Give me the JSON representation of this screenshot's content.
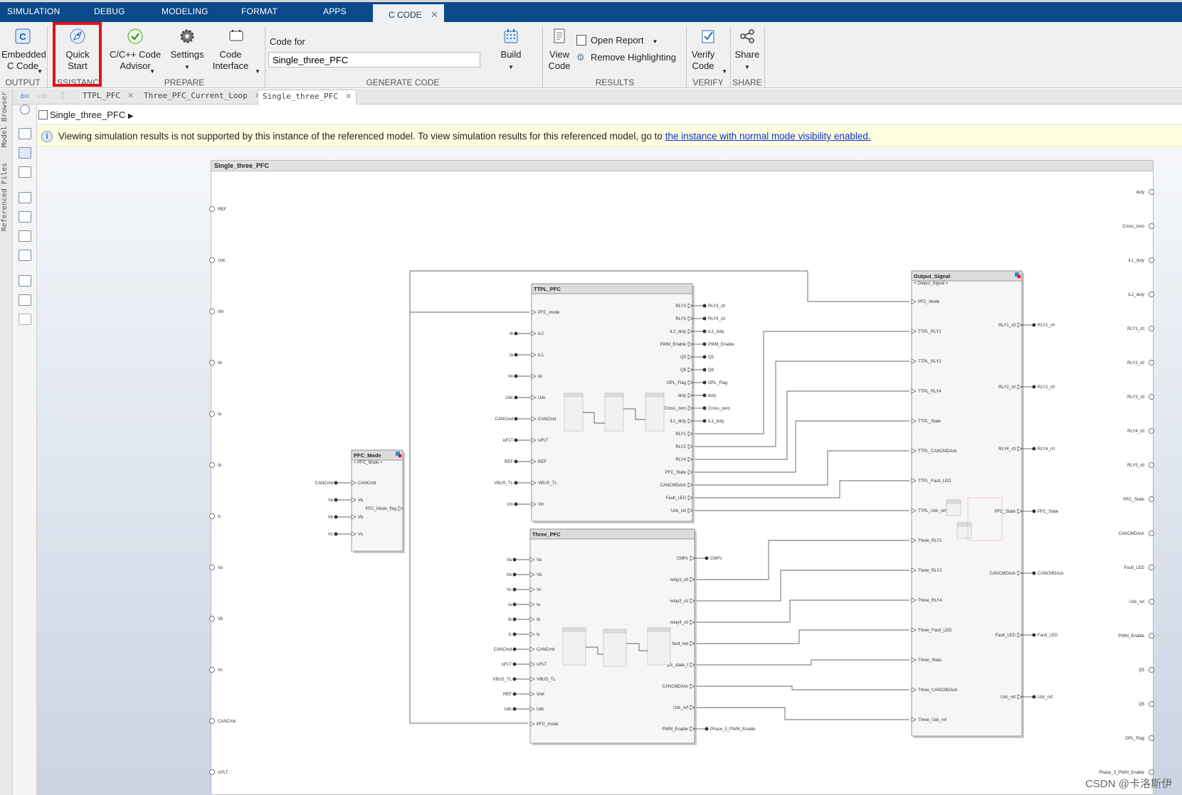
{
  "main_tabs": [
    "SIMULATION",
    "DEBUG",
    "MODELING",
    "FORMAT",
    "APPS"
  ],
  "active_tab": "C CODE",
  "ribbon": {
    "embedded": "Embedded C Code",
    "quick_start": "Quick Start",
    "advisor": "C/C++ Code Advisor",
    "settings": "Settings",
    "code_interface": "Code Interface",
    "code_for_label": "Code for",
    "code_for_value": "Single_three_PFC",
    "build": "Build",
    "view_code": "View Code",
    "open_report": "Open Report",
    "remove_highlighting": "Remove Highlighting",
    "verify_code": "Verify Code",
    "share": "Share",
    "groups": {
      "output": "OUTPUT",
      "assistance": "SSISTANC",
      "prepare": "PREPARE",
      "generate": "GENERATE CODE",
      "results": "RESULTS",
      "verify": "VERIFY",
      "share": "SHARE"
    }
  },
  "file_tabs": [
    "TTPL_PFC",
    "Three_PFC_Current_Loop",
    "Single_three_PFC"
  ],
  "side_labels": {
    "browser": "Model Browser",
    "files": "Referenced Files"
  },
  "breadcrumb": "Single_three_PFC",
  "info": {
    "message": "Viewing simulation results is not supported by this instance of the referenced model. To view simulation results for this referenced model, go to",
    "link": "the instance with normal mode visibility enabled."
  },
  "model_title": "Single_three_PFC",
  "inports": [
    "REF",
    "Udc",
    "Vin",
    "Iin",
    "Ia",
    "Ib",
    "Ic",
    "Va",
    "Vb",
    "Vc",
    "CANCmd",
    "isFLT"
  ],
  "outports": [
    "duty",
    "Cross_zero",
    "iL1_duty",
    "iL2_duty",
    "RLY1_ctl",
    "RLY2_ctl",
    "RLY3_ctl",
    "RLY4_ctl",
    "RLY5_ctl",
    "PFC_State",
    "CANCMDAck",
    "Fault_LED",
    "Udc_ref",
    "PWM_Enable",
    "Q5",
    "Q6",
    "OPL_Flag",
    "Phase_3_PWM_Enable"
  ],
  "blocks": {
    "pfc_mode": {
      "title": "PFC_Mode",
      "subtitle": "< PFC_Mode >",
      "inputs": [
        "CANCmd",
        "Va",
        "Vb",
        "Vc"
      ],
      "input_signals": [
        "CANCmd",
        "Va",
        "Vb",
        "Vc"
      ],
      "outputs": [
        "PFC_Mode_flag"
      ],
      "output_signal": "PFC_Mode_flg"
    },
    "ttpl": {
      "title": "TTPL_PFC",
      "inputs": [
        "PFC_mode",
        "iL2",
        "iL1",
        "Iin",
        "Udc",
        "CANCmd",
        "isFLT",
        "REF",
        "VBUS_TL",
        "Vin"
      ],
      "input_signals": [
        "",
        "Ib",
        "Ia",
        "Iin",
        "Udc",
        "CANCmd",
        "isFLT",
        "REF",
        "VBUS_TL",
        "Vin"
      ],
      "outputs": [
        "RLY3",
        "RLY5",
        "iL2_duty",
        "PWM_Enable",
        "Q5",
        "Q6",
        "OPL_Flag",
        "duty",
        "Cross_zero",
        "iL1_duty",
        "RLY1",
        "RLY2",
        "RLY4",
        "PFC_State",
        "CANCMDAck",
        "Fault_LED",
        "Udc_ref"
      ],
      "output_signals": [
        "RLY3_ctl",
        "RLY5_ctl",
        "iL2_duty",
        "PWM_Enable",
        "Q5",
        "Q6",
        "OPL_Flag",
        "duty",
        "Cross_zero",
        "iL1_duty",
        "",
        "",
        "",
        "",
        "",
        "",
        ""
      ]
    },
    "three": {
      "title": "Three_PFC",
      "inputs": [
        "Va",
        "Vb",
        "Vc",
        "Ia",
        "Ib",
        "Ic",
        "CANCmd",
        "isFLT",
        "VBUS_TL",
        "Vref",
        "Udc",
        "PFC_mode"
      ],
      "input_signals": [
        "Va",
        "Vb",
        "Vc",
        "Ia",
        "Ib",
        "Ic",
        "CANCmd",
        "isFLT",
        "VBUS_TL",
        "REF",
        "Udc",
        ""
      ],
      "outputs": [
        "CMPx",
        "relay1_ctl",
        "relay2_ctl",
        "relay4_ctl",
        "fault_led",
        "pfc_state_t",
        "CANCMDAck",
        "Udc_ref",
        "PWM_Enable"
      ],
      "output_signals": [
        "CMPx",
        "",
        "",
        "",
        "",
        "",
        "",
        "",
        "Phase_3_PWM_Enable"
      ]
    },
    "output_signal": {
      "title": "Output_Signal",
      "subtitle": "< Output_Signal >",
      "inputs": [
        "PFC_Mode",
        "TTPL_RLY1",
        "TTPL_RLY2",
        "TTPL_RLY4",
        "TTPL_State",
        "TTPL_CANCMDAck",
        "TTPL_Fault_LED",
        "TTPL_Udc_ref",
        "Three_RLY1",
        "Three_RLY2",
        "Three_RLY4",
        "Three_Fault_LED",
        "Three_State",
        "Three_CANCMDAck",
        "Three_Udc_ref"
      ],
      "outputs": [
        "RLY1_ctl",
        "RLY2_ctl",
        "RLY4_ctl",
        "PFC_State",
        "CANCMDAck",
        "Fault_LED",
        "Udc_ref"
      ],
      "output_signals": [
        "RLY1_ctl",
        "RLY2_ctl",
        "RLY4_ctl",
        "PFC_State",
        "CANCMDAck",
        "Fault_LED",
        "Udc_ref"
      ]
    }
  },
  "watermark": "CSDN @卡洛斯伊",
  "colors": {
    "ribbon_tabbar": "#0a4a8a",
    "highlight": "#e4101a",
    "info_bg": "#fffde0",
    "link": "#0a2fd0"
  }
}
